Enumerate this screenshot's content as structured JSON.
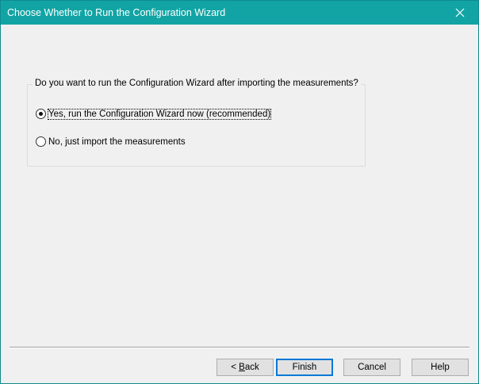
{
  "window": {
    "title": "Choose Whether to Run the Configuration Wizard",
    "close_glyph": "✕"
  },
  "question": {
    "label": "Do you want to run the Configuration Wizard after importing the measurements?",
    "options": [
      {
        "label": "Yes, run the Configuration Wizard now (recommended)",
        "selected": true
      },
      {
        "label": "No, just import the measurements",
        "selected": false
      }
    ]
  },
  "buttons": {
    "back_prefix": "< ",
    "back_mnemonic": "B",
    "back_rest": "ack",
    "finish": "Finish",
    "cancel": "Cancel",
    "help": "Help"
  },
  "colors": {
    "titlebar": "#12a4a4",
    "window_bg": "#f0f0f0",
    "default_button_border": "#0078d7"
  }
}
